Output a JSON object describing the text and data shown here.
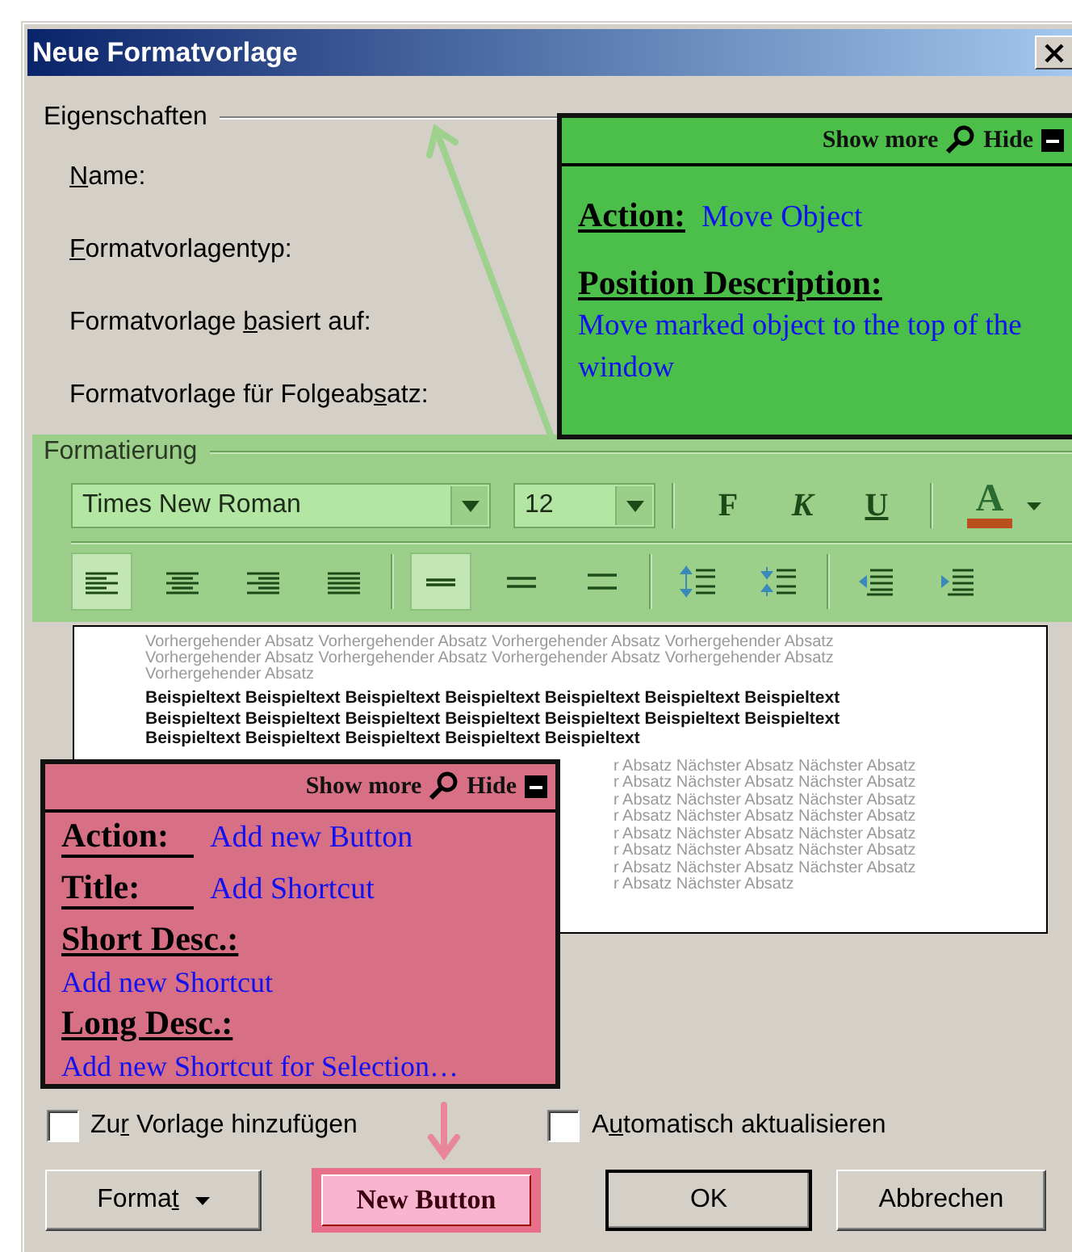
{
  "window": {
    "title": "Neue Formatvorlage"
  },
  "properties": {
    "legend": "Eigenschaften",
    "labels": [
      {
        "key": "N",
        "post": "ame:"
      },
      {
        "key": "F",
        "post": "ormatvorlagentyp:"
      },
      {
        "pre": "Formatvorlage ",
        "key": "b",
        "post": "asiert auf:"
      },
      {
        "pre": "Formatvorlage für Folgeab",
        "key": "s",
        "post": "atz:"
      }
    ]
  },
  "formatting": {
    "legend": "Formatierung",
    "highlighted": true,
    "font": "Times New Roman",
    "size": "12",
    "styles": [
      "F",
      "K",
      "U"
    ],
    "font_color": "A",
    "alignment": [
      {
        "kind": "left",
        "selected": true
      },
      {
        "kind": "center",
        "selected": false
      },
      {
        "kind": "right",
        "selected": false
      },
      {
        "kind": "justify",
        "selected": false
      }
    ],
    "spacing": [
      {
        "kind": "single",
        "selected": true
      },
      {
        "kind": "onehalf",
        "selected": false
      },
      {
        "kind": "double",
        "selected": false
      }
    ]
  },
  "preview": {
    "preceding": "Vorhergehender Absatz Vorhergehender Absatz Vorhergehender Absatz Vorhergehender Absatz Vorhergehender Absatz Vorhergehender Absatz Vorhergehender Absatz Vorhergehender Absatz Vorhergehender Absatz",
    "sample": "Beispieltext Beispieltext Beispieltext Beispieltext Beispieltext Beispieltext Beispieltext Beispieltext Beispieltext Beispieltext Beispieltext Beispieltext Beispieltext Beispieltext Beispieltext Beispieltext Beispieltext Beispieltext Beispieltext",
    "following": [
      "r Absatz Nächster Absatz Nächster Absatz",
      "r Absatz Nächster Absatz Nächster Absatz",
      "r Absatz Nächster Absatz Nächster Absatz",
      "r Absatz Nächster Absatz Nächster Absatz",
      "r Absatz Nächster Absatz Nächster Absatz",
      "r Absatz Nächster Absatz Nächster Absatz",
      "r Absatz Nächster Absatz Nächster Absatz",
      "r Absatz Nächster Absatz"
    ]
  },
  "checkboxes": [
    {
      "label": {
        "pre": "Zu",
        "key": "r",
        "post": " Vorlage hinzufügen"
      },
      "checked": false
    },
    {
      "label": {
        "pre": "A",
        "key": "u",
        "post": "tomatisch aktualisieren"
      },
      "checked": false
    }
  ],
  "buttons": [
    {
      "kind": "menu",
      "label": {
        "pre": "Forma",
        "key": "t"
      }
    },
    {
      "kind": "new",
      "label": {
        "pre": "New Button"
      },
      "highlighted": true
    },
    {
      "kind": "default",
      "label": {
        "pre": "OK"
      }
    },
    {
      "kind": "plain",
      "label": {
        "pre": "Abbrechen"
      }
    }
  ],
  "annotations": [
    {
      "color": "#4cbf4a",
      "show_more": "Show more",
      "hide": "Hide",
      "rows": [
        {
          "kind": "pair",
          "label": "Action:",
          "value": "Move Object"
        },
        {
          "kind": "heading",
          "label": "Position Description:"
        },
        {
          "kind": "text",
          "value": "Move marked object to the top of the window"
        }
      ]
    },
    {
      "color": "#d87085",
      "show_more": "Show more",
      "hide": "Hide",
      "rows": [
        {
          "kind": "pair",
          "label": "Action:",
          "value": "Add new Button"
        },
        {
          "kind": "pair",
          "label": "Title:",
          "value": "Add Shortcut"
        },
        {
          "kind": "heading",
          "label": "Short Desc.:"
        },
        {
          "kind": "text",
          "value": "Add new Shortcut"
        },
        {
          "kind": "heading",
          "label": "Long Desc.:"
        },
        {
          "kind": "text",
          "value": "Add new Shortcut for Selection…"
        }
      ]
    }
  ]
}
